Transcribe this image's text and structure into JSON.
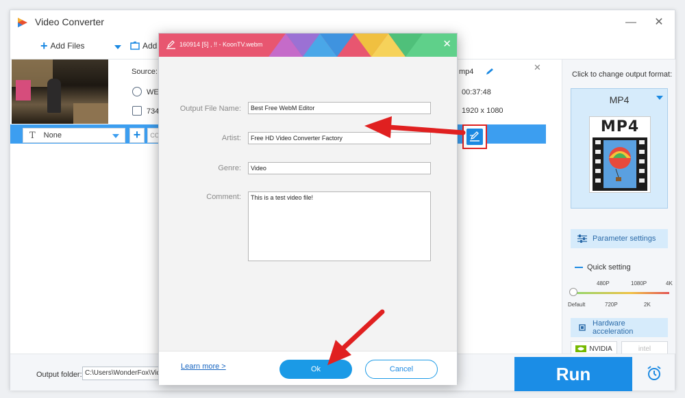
{
  "window": {
    "title": "Video Converter",
    "minimize_glyph": "—",
    "close_glyph": "✕"
  },
  "toolbar": {
    "add_files_label": "Add Files",
    "add_folder_label": "Add"
  },
  "file_item": {
    "source_label": "Source:",
    "output_name": "mp4",
    "format_abbrev": "WE",
    "size_abbrev": "734",
    "duration": "00:37:48",
    "resolution": "1920 x 1080"
  },
  "subtitle_bar": {
    "subtitle_value": "None",
    "t_glyph": "T",
    "cut_abbrev": "CO"
  },
  "dialog": {
    "title": "160914 [5]    ,  !! - KoonTV.webm",
    "close_glyph": "✕",
    "fields": {
      "output_file_name": {
        "label": "Output File Name:",
        "value": "Best Free WebM Editor"
      },
      "artist": {
        "label": "Artist:",
        "value": "Free HD Video Converter Factory"
      },
      "genre": {
        "label": "Genre:",
        "value": "Video"
      },
      "comment": {
        "label": "Comment:",
        "value": "This is a test video file!"
      }
    },
    "learn_more": "Learn more >",
    "ok_label": "Ok",
    "cancel_label": "Cancel"
  },
  "right_panel": {
    "change_format_label": "Click to change output format:",
    "format": "MP4",
    "format_tile_text": "MP4",
    "parameter_settings": "Parameter settings",
    "quick_setting": "Quick setting",
    "quality_top_labels": [
      "480P",
      "1080P",
      "4K"
    ],
    "quality_bottom_labels": [
      "Default",
      "720P",
      "2K"
    ],
    "quality_level": 0,
    "hardware_acceleration": "Hardware acceleration",
    "nvidia_label": "NVIDIA",
    "intel_label": "intel"
  },
  "bottom_bar": {
    "output_folder_label": "Output folder:",
    "output_folder_value": "C:\\Users\\WonderFox\\Video",
    "run_label": "Run"
  },
  "colors": {
    "accent_blue": "#1b8de6",
    "annotation_red": "#e02020",
    "dialog_header_band": [
      "#e85670",
      "#c56bc9",
      "#4aa7e8",
      "#f3c43a",
      "#5fd08a"
    ]
  }
}
